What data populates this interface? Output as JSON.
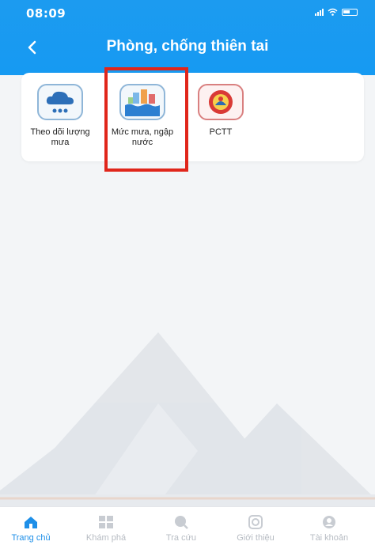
{
  "status_bar": {
    "time": "08:09"
  },
  "header": {
    "title": "Phòng, chống thiên tai"
  },
  "tiles": [
    {
      "label": "Theo dõi lượng mưa",
      "icon": "rain-cloud-icon"
    },
    {
      "label": "Mức mưa, ngập nước",
      "icon": "flood-town-icon"
    },
    {
      "label": "PCTT",
      "icon": "pctt-emblem-icon"
    }
  ],
  "tabs": [
    {
      "label": "Trang chủ",
      "icon": "home-icon",
      "active": true
    },
    {
      "label": "Khám phá",
      "icon": "grid-icon"
    },
    {
      "label": "Tra cứu",
      "icon": "search-icon"
    },
    {
      "label": "Giới thiệu",
      "icon": "info-icon"
    },
    {
      "label": "Tài khoản",
      "icon": "account-icon"
    }
  ],
  "colors": {
    "brand": "#169af2",
    "highlight": "#e0261b",
    "active_tab": "#1e8fe8"
  }
}
